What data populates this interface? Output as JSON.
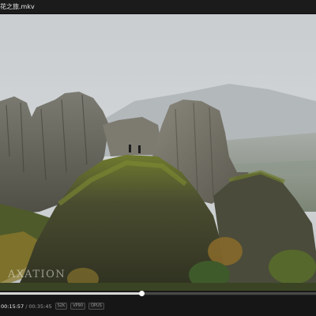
{
  "window": {
    "title": "花之旅.mkv"
  },
  "video": {
    "watermark_text": "AXATION"
  },
  "player": {
    "current_time": "00:15:57",
    "separator": "/",
    "duration": "00:35:45",
    "progress_fraction": 0.4464,
    "badges": [
      "S2K",
      "VP90",
      "OPUS"
    ]
  }
}
